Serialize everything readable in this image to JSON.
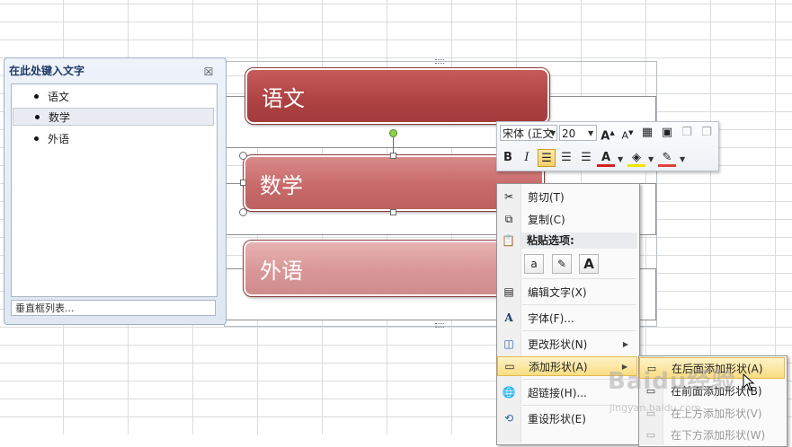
{
  "text_pane": {
    "title": "在此处键入文字",
    "close_symbol": "☒",
    "items": [
      {
        "label": "语文",
        "selected": false
      },
      {
        "label": "数学",
        "selected": true
      },
      {
        "label": "外语",
        "selected": false
      }
    ],
    "footer": "垂直框列表..."
  },
  "smartart": {
    "shapes": [
      "语文",
      "数学",
      "外语"
    ],
    "colors": {
      "shape1": "#b04343",
      "shape2": "#c86a6a",
      "shape3": "#d99797",
      "handle_green": "#8fd14f"
    }
  },
  "mini_toolbar": {
    "font_name": "宋体 (正文",
    "font_size": "20",
    "grow_font": "A",
    "shrink_font": "A",
    "bold": "B",
    "italic": "I",
    "font_color": "A",
    "accent_red": "#d32020",
    "highlight_yellow": "#f2e600"
  },
  "context_menu": {
    "items": [
      {
        "label": "剪切(T)",
        "icon": "scissors-icon"
      },
      {
        "label": "复制(C)",
        "icon": "copy-icon"
      },
      {
        "label": "编辑文字(X)",
        "icon": "edit-text-icon"
      },
      {
        "label": "字体(F)...",
        "icon": "font-icon"
      },
      {
        "label": "更改形状(N)",
        "icon": "change-shape-icon"
      },
      {
        "label": "添加形状(A)",
        "icon": "add-shape-icon"
      },
      {
        "label": "超链接(H)...",
        "icon": "hyperlink-icon"
      },
      {
        "label": "重设形状(E)",
        "icon": "reset-shape-icon"
      }
    ],
    "paste_header": "粘贴选项:",
    "paste_buttons": [
      "a",
      "✎",
      "A"
    ]
  },
  "submenu": {
    "items": [
      {
        "label": "在后面添加形状(A)",
        "highlighted": true,
        "disabled": false
      },
      {
        "label": "在前面添加形状(B)",
        "highlighted": false,
        "disabled": false
      },
      {
        "label": "在上方添加形状(V)",
        "highlighted": false,
        "disabled": true
      },
      {
        "label": "在下方添加形状(W)",
        "highlighted": false,
        "disabled": true
      }
    ]
  },
  "watermark": {
    "logo": "Baidu经验",
    "url": "jingyan.baidu.com"
  }
}
